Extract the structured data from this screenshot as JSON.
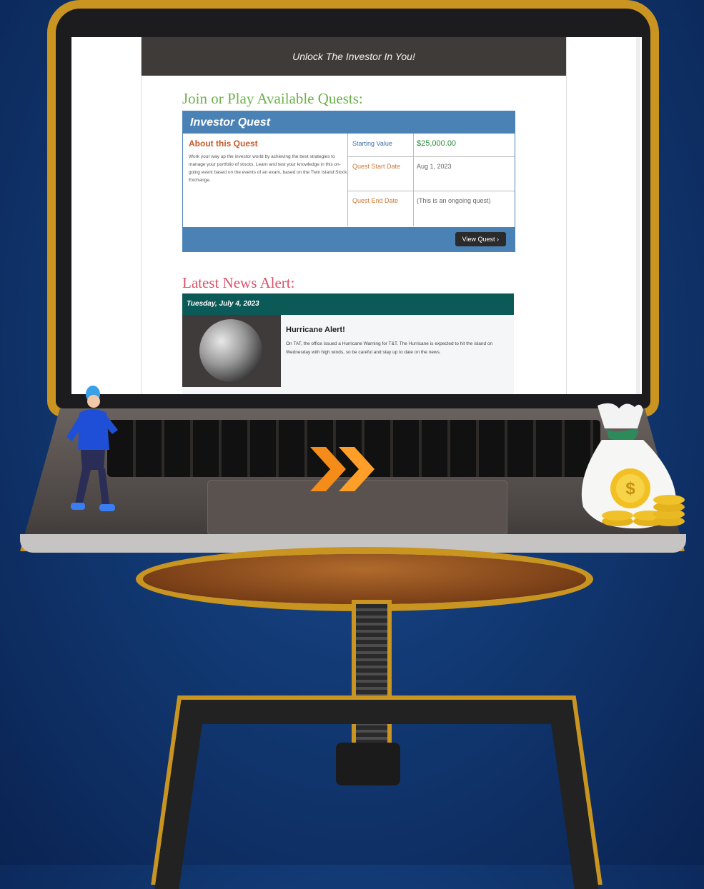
{
  "header": {
    "tagline": "Unlock The Investor In You!"
  },
  "quests": {
    "heading": "Join or Play Available Quests:",
    "card_title": "Investor Quest",
    "about_heading": "About this Quest",
    "about_text": "Work your way up the investor world by achieving the best strategies to manage your portfolio of stocks. Learn and test your knowledge in this on-going event based on the events of an exam, based on the Twin Island Stock Exchange.",
    "stats": [
      {
        "label": "Starting Value",
        "value": "$25,000.00"
      },
      {
        "label": "Quest Start Date",
        "value": "Aug 1, 2023"
      },
      {
        "label": "Quest End Date",
        "value": "(This is an ongoing quest)"
      }
    ],
    "view_button": "View Quest"
  },
  "news": {
    "heading": "Latest News Alert:",
    "date": "Tuesday, July 4, 2023",
    "title": "Hurricane Alert!",
    "body": "On TAT, the office issued a Hurricane Warning for T&T. The Hurricane is expected to hit the island on Wednesday with high winds, so be careful and stay up to date on the news."
  },
  "colors": {
    "background": "#123a75",
    "outline": "#c99520",
    "quest_green": "#6cb24a",
    "quest_blue": "#4a82b6",
    "news_pink": "#d9536b",
    "news_teal": "#0b5a57"
  }
}
